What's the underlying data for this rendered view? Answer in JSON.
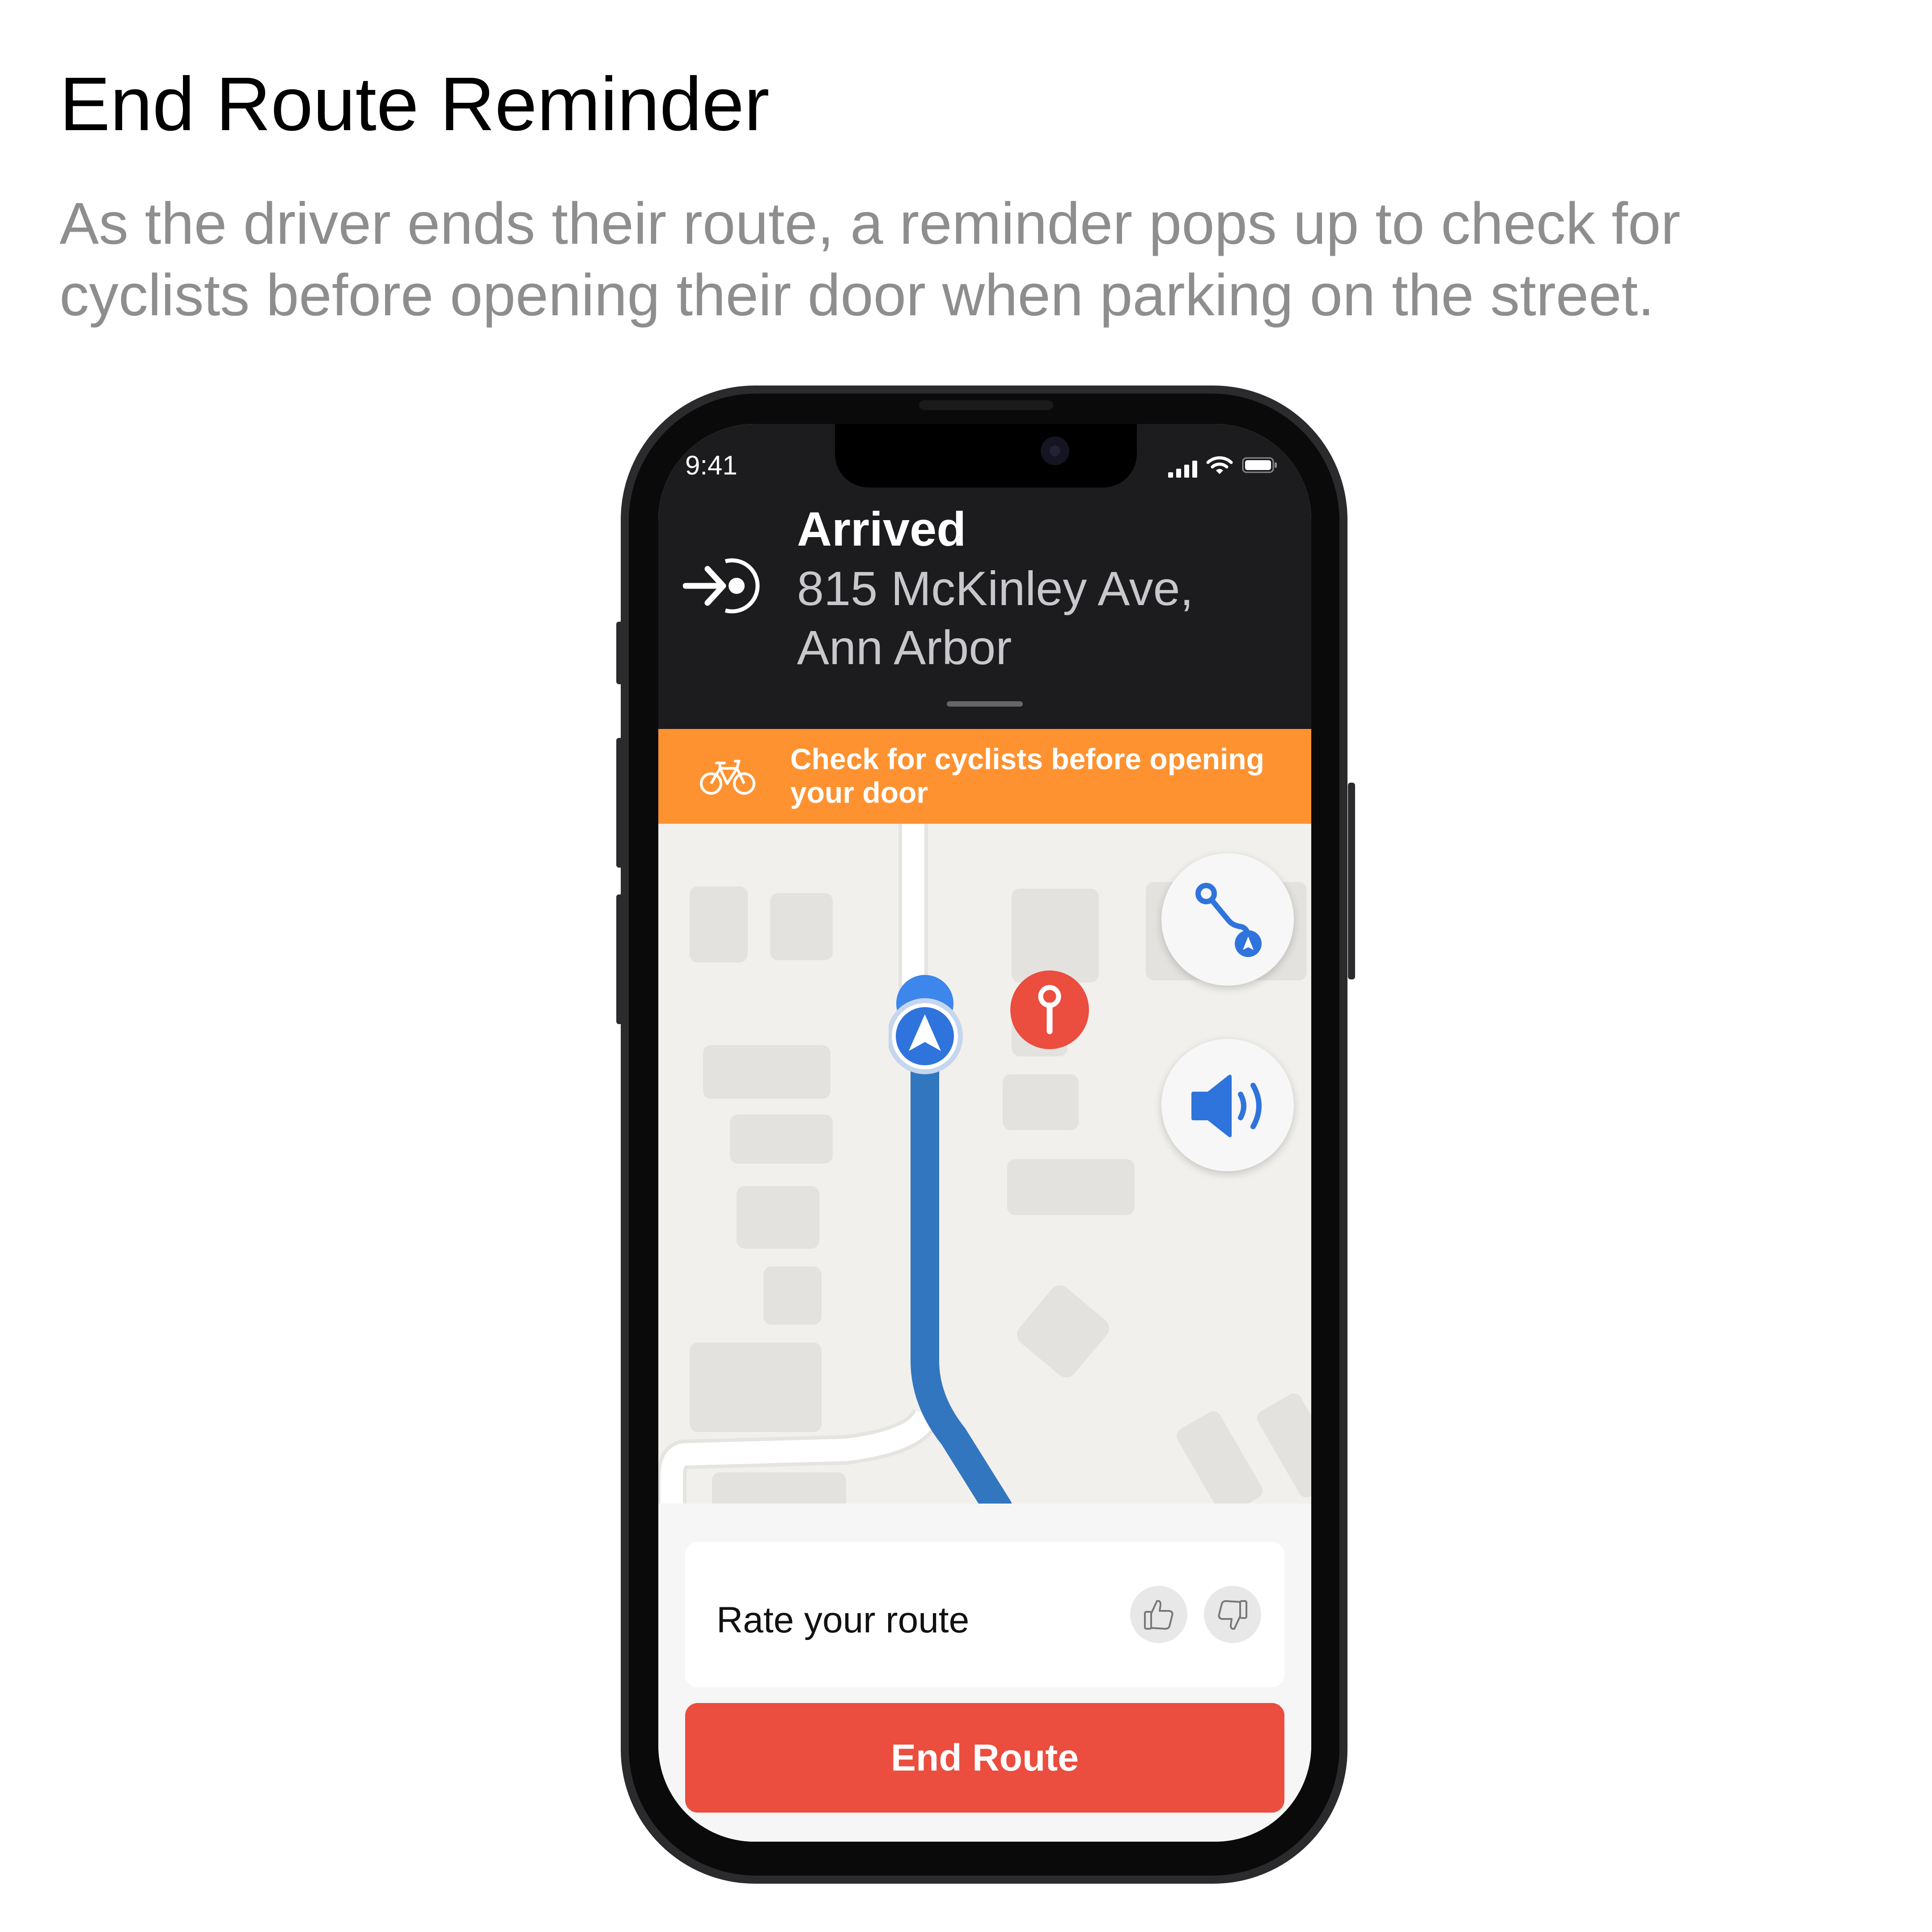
{
  "page": {
    "title": "End Route Reminder",
    "description": "As the driver ends their route, a reminder pops up to check for cyclists before opening their door when parking on the street."
  },
  "status_bar": {
    "time": "9:41",
    "icons": [
      "cellular-signal-icon",
      "wifi-icon",
      "battery-icon"
    ]
  },
  "navigation_header": {
    "icon": "arrive-destination-icon",
    "status": "Arrived",
    "address": "815 McKinley Ave, Ann Arbor"
  },
  "reminder_banner": {
    "icon": "bicycle-icon",
    "text": "Check for cyclists before opening your door",
    "color": "#ff9230"
  },
  "map": {
    "route_color": "#3276bf",
    "destination_pin_color": "#eb4d3f",
    "controls": [
      "route-overview-icon",
      "sound-on-icon"
    ]
  },
  "bottom_sheet": {
    "rate_label": "Rate your route",
    "feedback_icons": [
      "thumbs-up-icon",
      "thumbs-down-icon"
    ],
    "end_button_label": "End Route",
    "end_button_color": "#eb4d3f"
  }
}
